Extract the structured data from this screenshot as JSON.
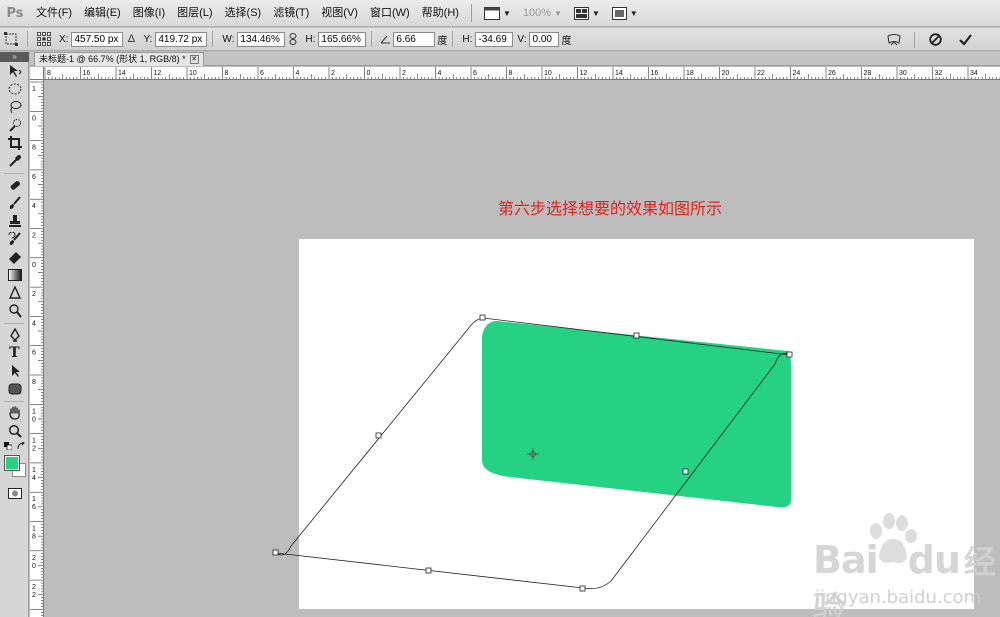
{
  "app": {
    "logo": "Ps"
  },
  "menu": [
    "文件(F)",
    "编辑(E)",
    "图像(I)",
    "图层(L)",
    "选择(S)",
    "滤镜(T)",
    "视图(V)",
    "窗口(W)",
    "帮助(H)"
  ],
  "menubar_tools": {
    "zoom": "100%"
  },
  "options": {
    "x_label": "X:",
    "x_value": "457.50 px",
    "y_label": "Y:",
    "y_value": "419.72 px",
    "w_label": "W:",
    "w_value": "134.46%",
    "h_label": "H:",
    "h_value": "165.66%",
    "angle_value": "6.66",
    "angle_unit": "度",
    "hskew_label": "H:",
    "hskew_value": "-34.69",
    "hskew_unit": "度",
    "vskew_label": "V:",
    "vskew_value": "0.00",
    "vskew_unit": "度"
  },
  "document": {
    "tab_title": "未标题-1 @ 66.7% (形状 1, RGB/8) *"
  },
  "ruler": {
    "top_labels": [
      "8",
      "16",
      "14",
      "12",
      "10",
      "8",
      "6",
      "4",
      "2",
      "0",
      "2",
      "4",
      "6",
      "8",
      "10",
      "12",
      "14",
      "16",
      "18",
      "20",
      "22",
      "24",
      "26",
      "28",
      "30",
      "32",
      "34"
    ],
    "left_labels": [
      "1",
      "0",
      "8",
      "6",
      "4",
      "2",
      "0",
      "2",
      "4",
      "6",
      "8",
      "1 0",
      "1 2",
      "1 4",
      "1 6",
      "1 8",
      "2 0",
      "2 2",
      "2 4"
    ]
  },
  "canvas": {
    "caption": "第六步选择想要的效果如图所示",
    "shape_color": "#25d183"
  },
  "colors": {
    "foreground": "#25d183",
    "background": "#ffffff"
  },
  "watermark": {
    "brand": "Bai",
    "brand2": "du",
    "cn": "经验",
    "url": "jingyan.baidu.com"
  }
}
